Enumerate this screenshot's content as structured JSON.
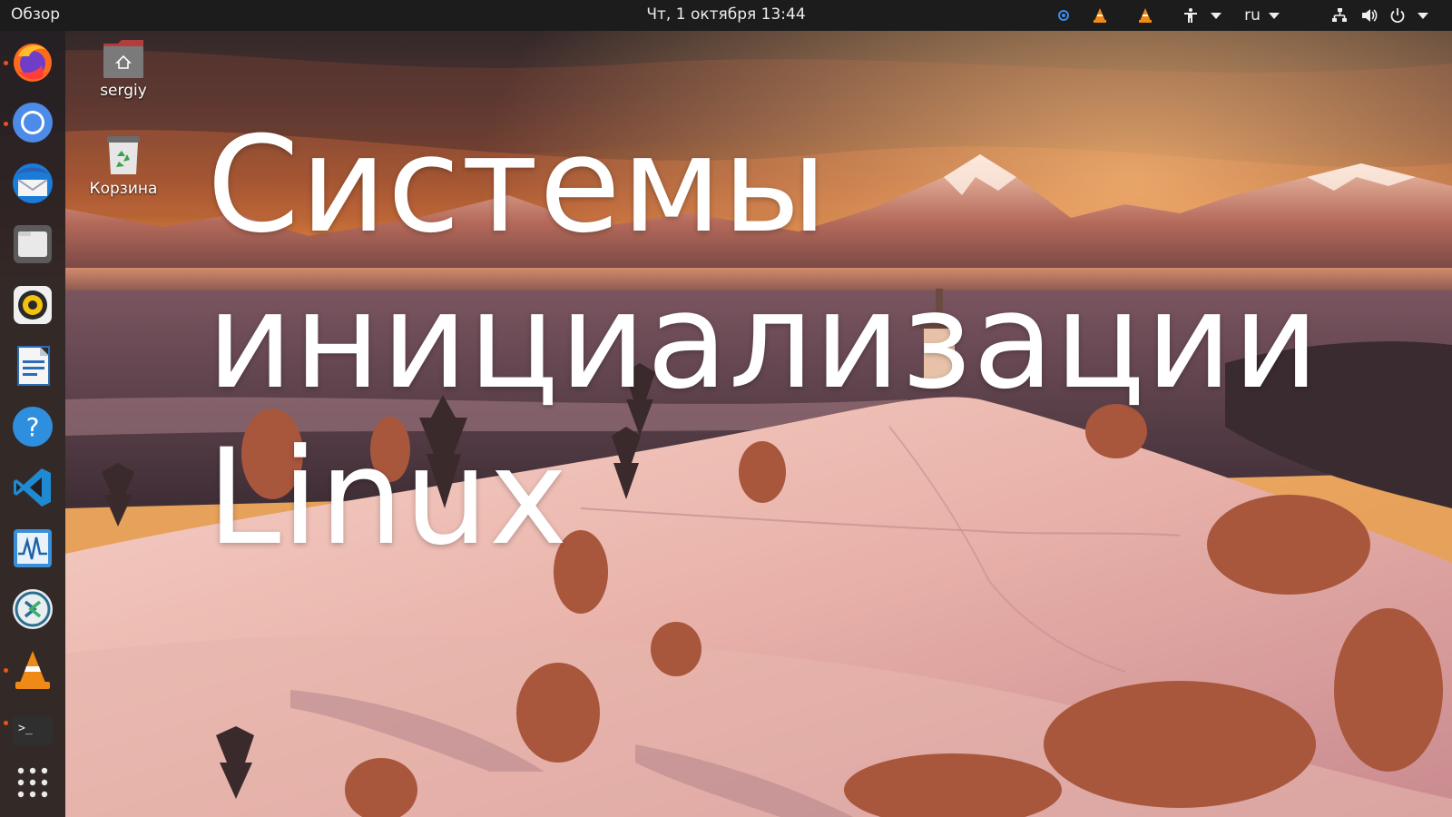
{
  "topbar": {
    "activities_label": "Обзор",
    "datetime": "Чт, 1 октября  13:44",
    "language": "ru"
  },
  "dock": {
    "apps": [
      {
        "name": "firefox",
        "running": true
      },
      {
        "name": "chromium",
        "running": true
      },
      {
        "name": "thunderbird",
        "running": false
      },
      {
        "name": "files",
        "running": false
      },
      {
        "name": "rhythmbox",
        "running": false
      },
      {
        "name": "libreoffice-writer",
        "running": false
      },
      {
        "name": "help",
        "running": false
      },
      {
        "name": "vscode",
        "running": false
      },
      {
        "name": "system-monitor",
        "running": false
      },
      {
        "name": "remmina",
        "running": false
      },
      {
        "name": "vlc",
        "running": true
      },
      {
        "name": "terminal",
        "running": true
      },
      {
        "name": "show-applications",
        "running": false
      }
    ]
  },
  "desktop": {
    "home_label": "sergiy",
    "trash_label": "Корзина"
  },
  "headline": {
    "line1": "Системы",
    "line2": "инициализации",
    "line3": "Linux"
  },
  "colors": {
    "accent": "#e95420",
    "topbar": "#1c1c1c",
    "dock": "#241f23"
  }
}
